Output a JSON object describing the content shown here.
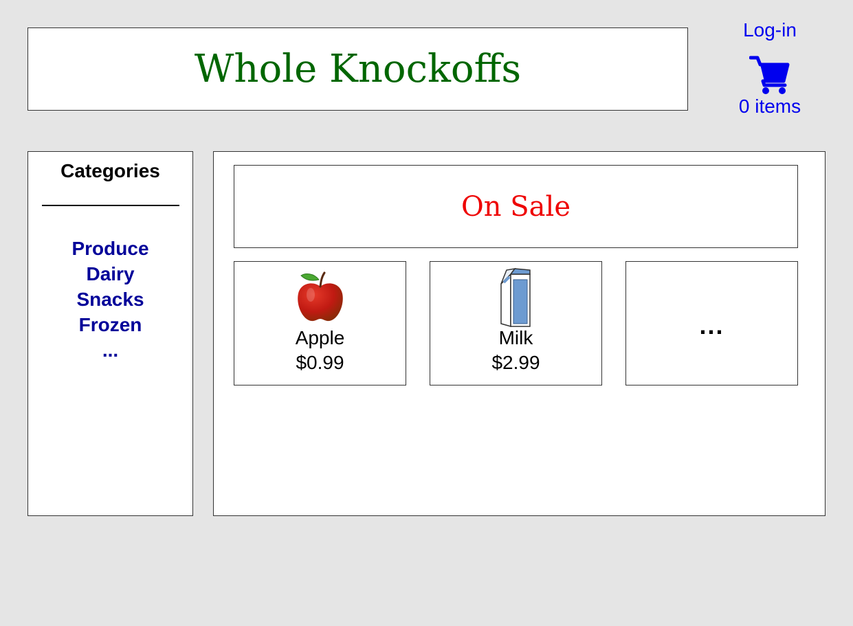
{
  "header": {
    "title": "Whole Knockoffs"
  },
  "account": {
    "login_label": "Log-in",
    "cart_count": "0 items",
    "cart_icon": "shopping-cart-icon"
  },
  "sidebar": {
    "title": "Categories",
    "items": [
      {
        "label": "Produce"
      },
      {
        "label": "Dairy"
      },
      {
        "label": "Snacks"
      },
      {
        "label": "Frozen"
      },
      {
        "label": "..."
      }
    ]
  },
  "main": {
    "banner": "On Sale",
    "products": [
      {
        "name": "Apple",
        "price": "$0.99",
        "icon": "apple-icon"
      },
      {
        "name": "Milk",
        "price": "$2.99",
        "icon": "milk-carton-icon"
      },
      {
        "more": "..."
      }
    ]
  },
  "colors": {
    "background": "#e5e5e5",
    "title": "#006600",
    "link": "#0000ee",
    "category": "#000099",
    "sale": "#ee0000"
  }
}
